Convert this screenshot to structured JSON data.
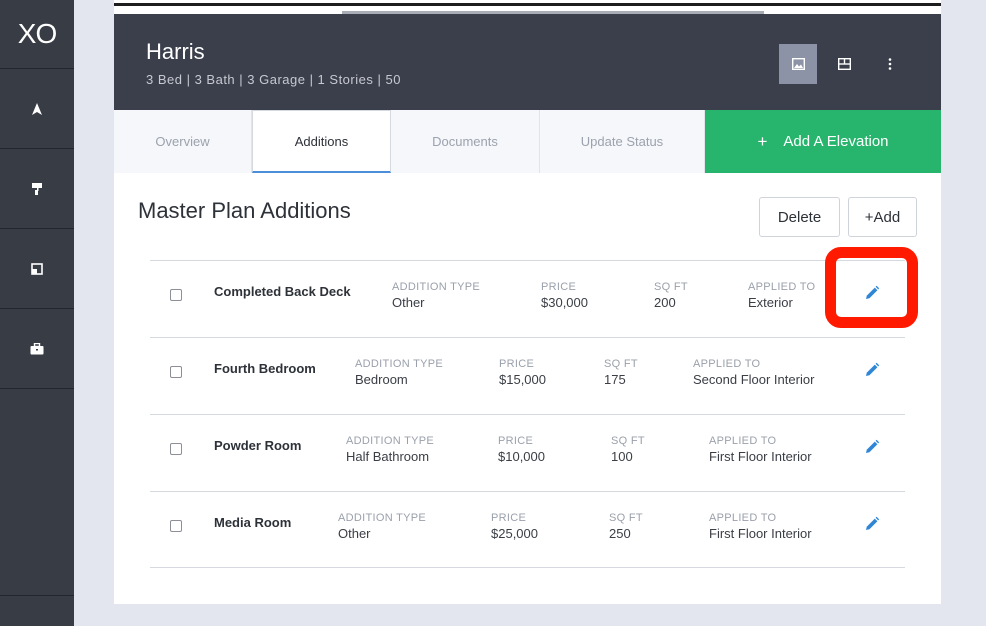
{
  "sidebar": {
    "logo": "XO",
    "items": [
      {
        "name": "navigate-icon"
      },
      {
        "name": "paint-roller-icon"
      },
      {
        "name": "floorplan-icon"
      },
      {
        "name": "briefcase-icon"
      }
    ]
  },
  "header": {
    "title": "Harris",
    "subtitle": "3 Bed | 3 Bath | 3 Garage | 1 Stories | 50"
  },
  "tabs": {
    "overview": "Overview",
    "additions": "Additions",
    "documents": "Documents",
    "update_status": "Update Status",
    "add_elevation_plus": "+",
    "add_elevation": "Add A Elevation"
  },
  "section": {
    "title": "Master Plan Additions",
    "delete_label": "Delete",
    "add_label": "+Add"
  },
  "labels": {
    "addition_type": "ADDITION TYPE",
    "price": "PRICE",
    "sq_ft": "SQ FT",
    "applied_to": "APPLIED TO"
  },
  "rows": [
    {
      "name": "Completed Back Deck",
      "type": "Other",
      "price": "$30,000",
      "sqft": "200",
      "applied": "Exterior"
    },
    {
      "name": "Fourth Bedroom",
      "type": "Bedroom",
      "price": "$15,000",
      "sqft": "175",
      "applied": "Second Floor Interior"
    },
    {
      "name": "Powder Room",
      "type": "Half Bathroom",
      "price": "$10,000",
      "sqft": "100",
      "applied": "First Floor Interior"
    },
    {
      "name": "Media Room",
      "type": "Other",
      "price": "$25,000",
      "sqft": "250",
      "applied": "First Floor Interior"
    }
  ],
  "colors": {
    "accent_green": "#27b56e",
    "edit_blue": "#2f86d6",
    "highlight_red": "#ff1a00",
    "header_dark": "#3b3f4b"
  }
}
